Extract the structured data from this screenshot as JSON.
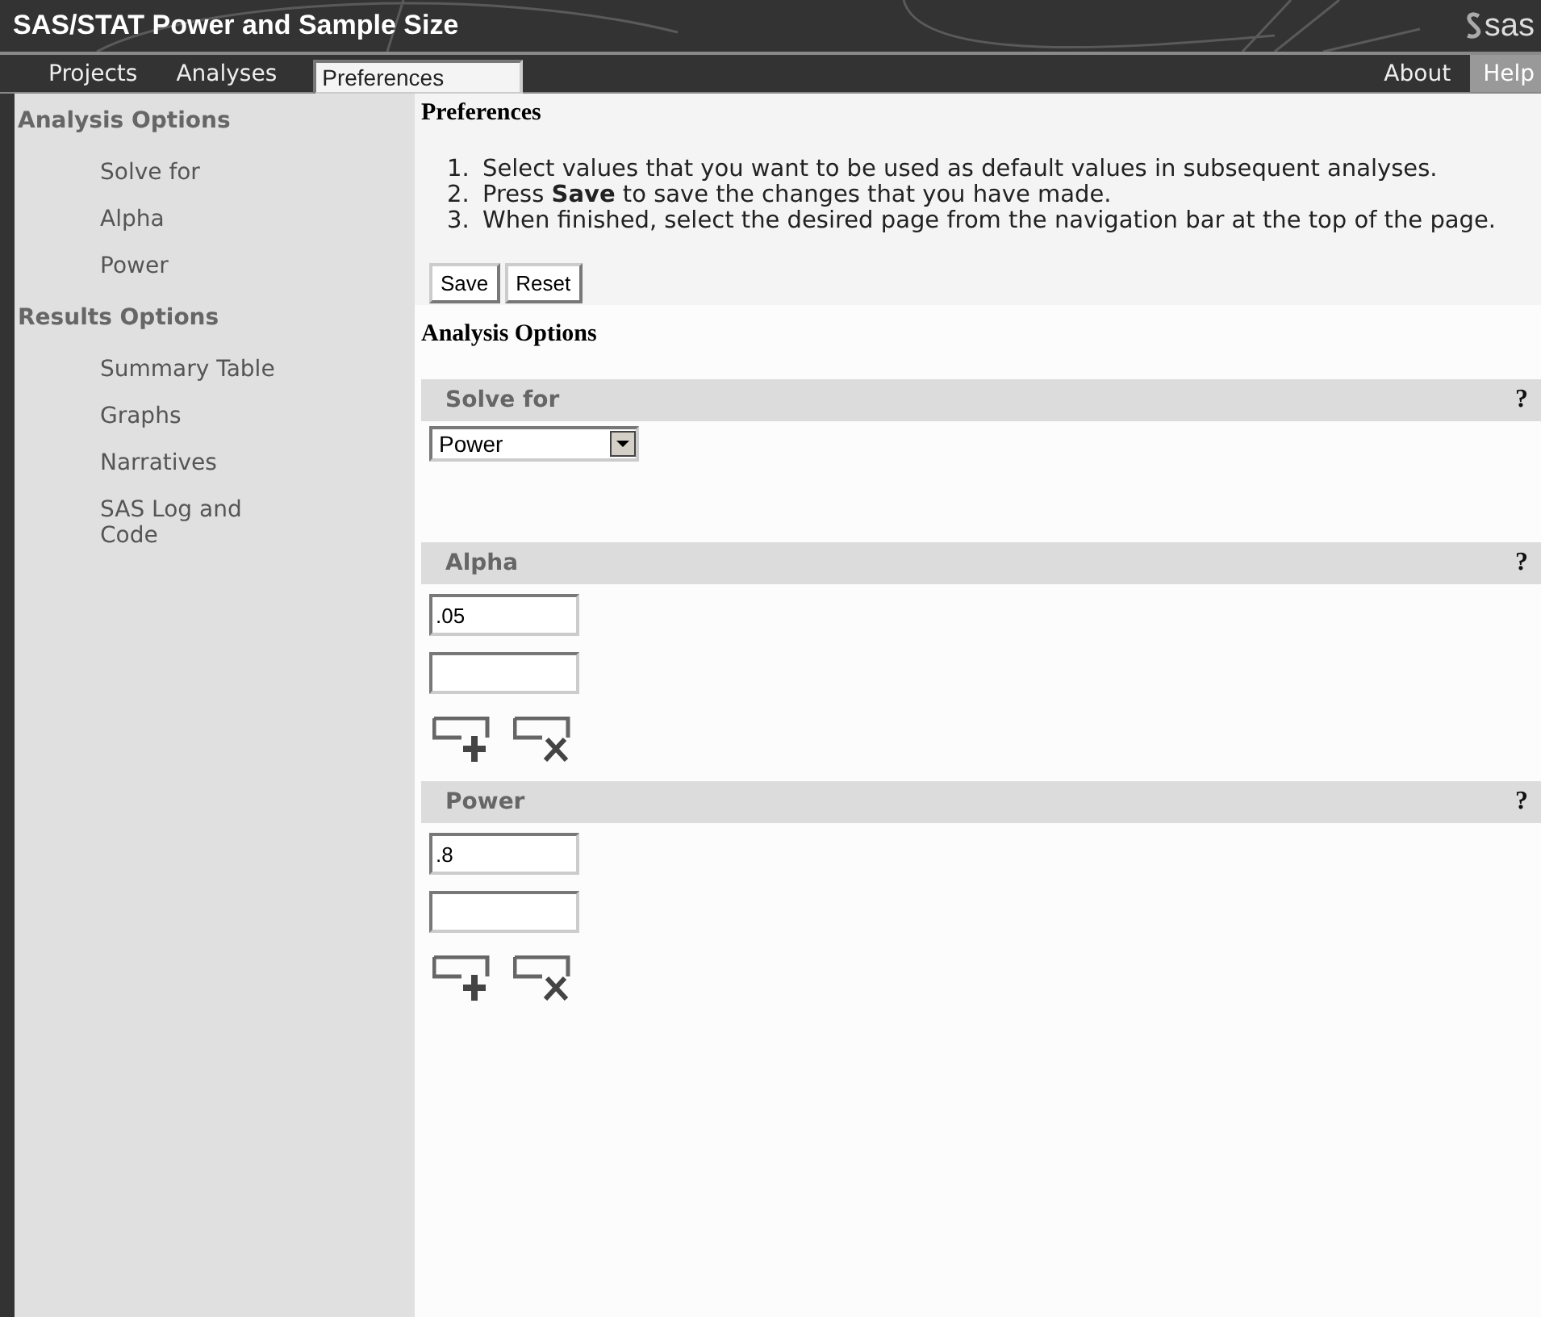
{
  "header": {
    "title": "SAS/STAT Power and Sample Size",
    "logo": "sas"
  },
  "nav": {
    "left": [
      {
        "label": "Projects",
        "selected": false
      },
      {
        "label": "Analyses",
        "selected": false
      },
      {
        "label": "Preferences",
        "selected": true
      }
    ],
    "right": [
      {
        "label": "About",
        "selected": false
      },
      {
        "label": "Help",
        "selected": true
      }
    ]
  },
  "sidebar": [
    {
      "heading": "Analysis Options",
      "items": [
        "Solve for",
        "Alpha",
        "Power"
      ]
    },
    {
      "heading": "Results Options",
      "items": [
        "Summary Table",
        "Graphs",
        "Narratives",
        "SAS Log and Code"
      ]
    }
  ],
  "page_title": "Preferences",
  "instructions": [
    {
      "number": "1.",
      "text": "Select values that you want to be used as default values in subsequent analyses."
    },
    {
      "number": "2.",
      "text": "Press **Save** to save the changes that you have made."
    },
    {
      "number": "3.",
      "text": "When finished, select the desired page from the navigation bar at the top of the page."
    }
  ],
  "buttons": [
    "Save",
    "Reset"
  ],
  "section_title": "Analysis Options",
  "options": [
    {
      "kind": "select",
      "label": "Solve for",
      "help": "?",
      "value": "Power"
    },
    {
      "kind": "list",
      "label": "Alpha",
      "help": "?",
      "fields": [
        {
          "kind": "text",
          "value": ".05"
        },
        {
          "kind": "blank"
        }
      ]
    },
    {
      "kind": "list",
      "label": "Power",
      "help": "?",
      "fields": [
        {
          "kind": "text",
          "value": ".8"
        },
        {
          "kind": "blank"
        }
      ]
    }
  ]
}
